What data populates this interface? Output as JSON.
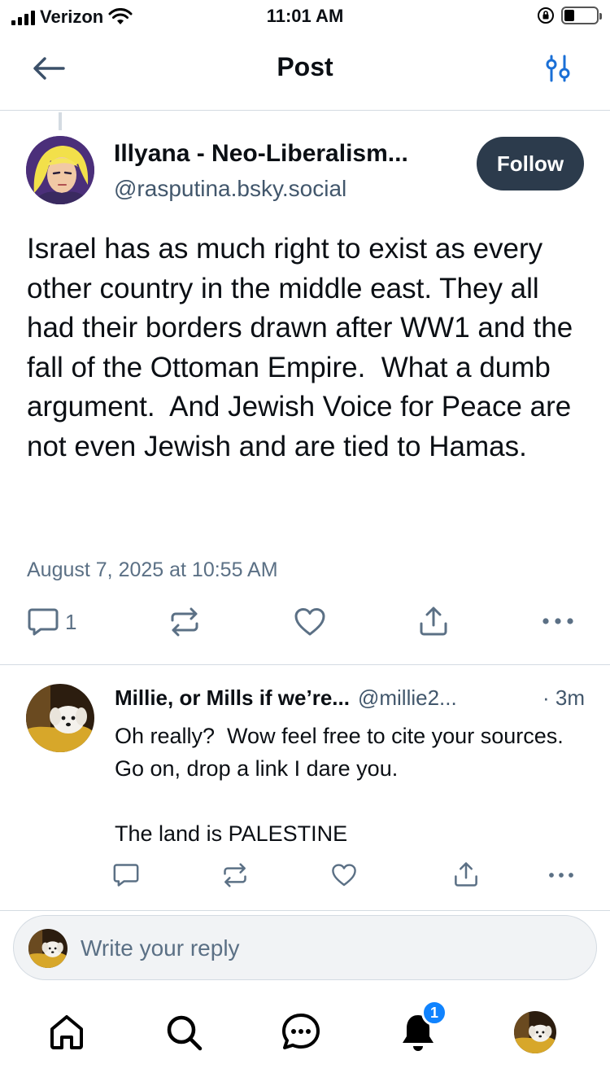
{
  "status_bar": {
    "carrier": "Verizon",
    "time": "11:01 AM"
  },
  "header": {
    "title": "Post"
  },
  "post": {
    "author_name": "Illyana - Neo-Liberalism...",
    "author_handle": "@rasputina.bsky.social",
    "follow_label": "Follow",
    "text": "Israel has as much right to exist as every other country in the middle east. They all had their borders drawn after WW1 and the fall of the Ottoman Empire.  What a dumb argument.  And Jewish Voice for Peace are not even Jewish and are tied to Hamas.",
    "date": "August 7, 2025 at 10:55 AM",
    "reply_count": "1"
  },
  "reply": {
    "author_name": "Millie, or Mills if we’re...",
    "author_handle": "@millie2...",
    "time": "· 3m",
    "text": "Oh really?  Wow feel free to cite your sources. Go on, drop a link I dare you.\n\nThe land is PALESTINE"
  },
  "compose": {
    "placeholder": "Write your reply"
  },
  "tabbar": {
    "notifications_badge": "1"
  },
  "colors": {
    "accent": "#1083fe",
    "follow_bg": "#2c3b4c",
    "muted": "#5b7085"
  }
}
